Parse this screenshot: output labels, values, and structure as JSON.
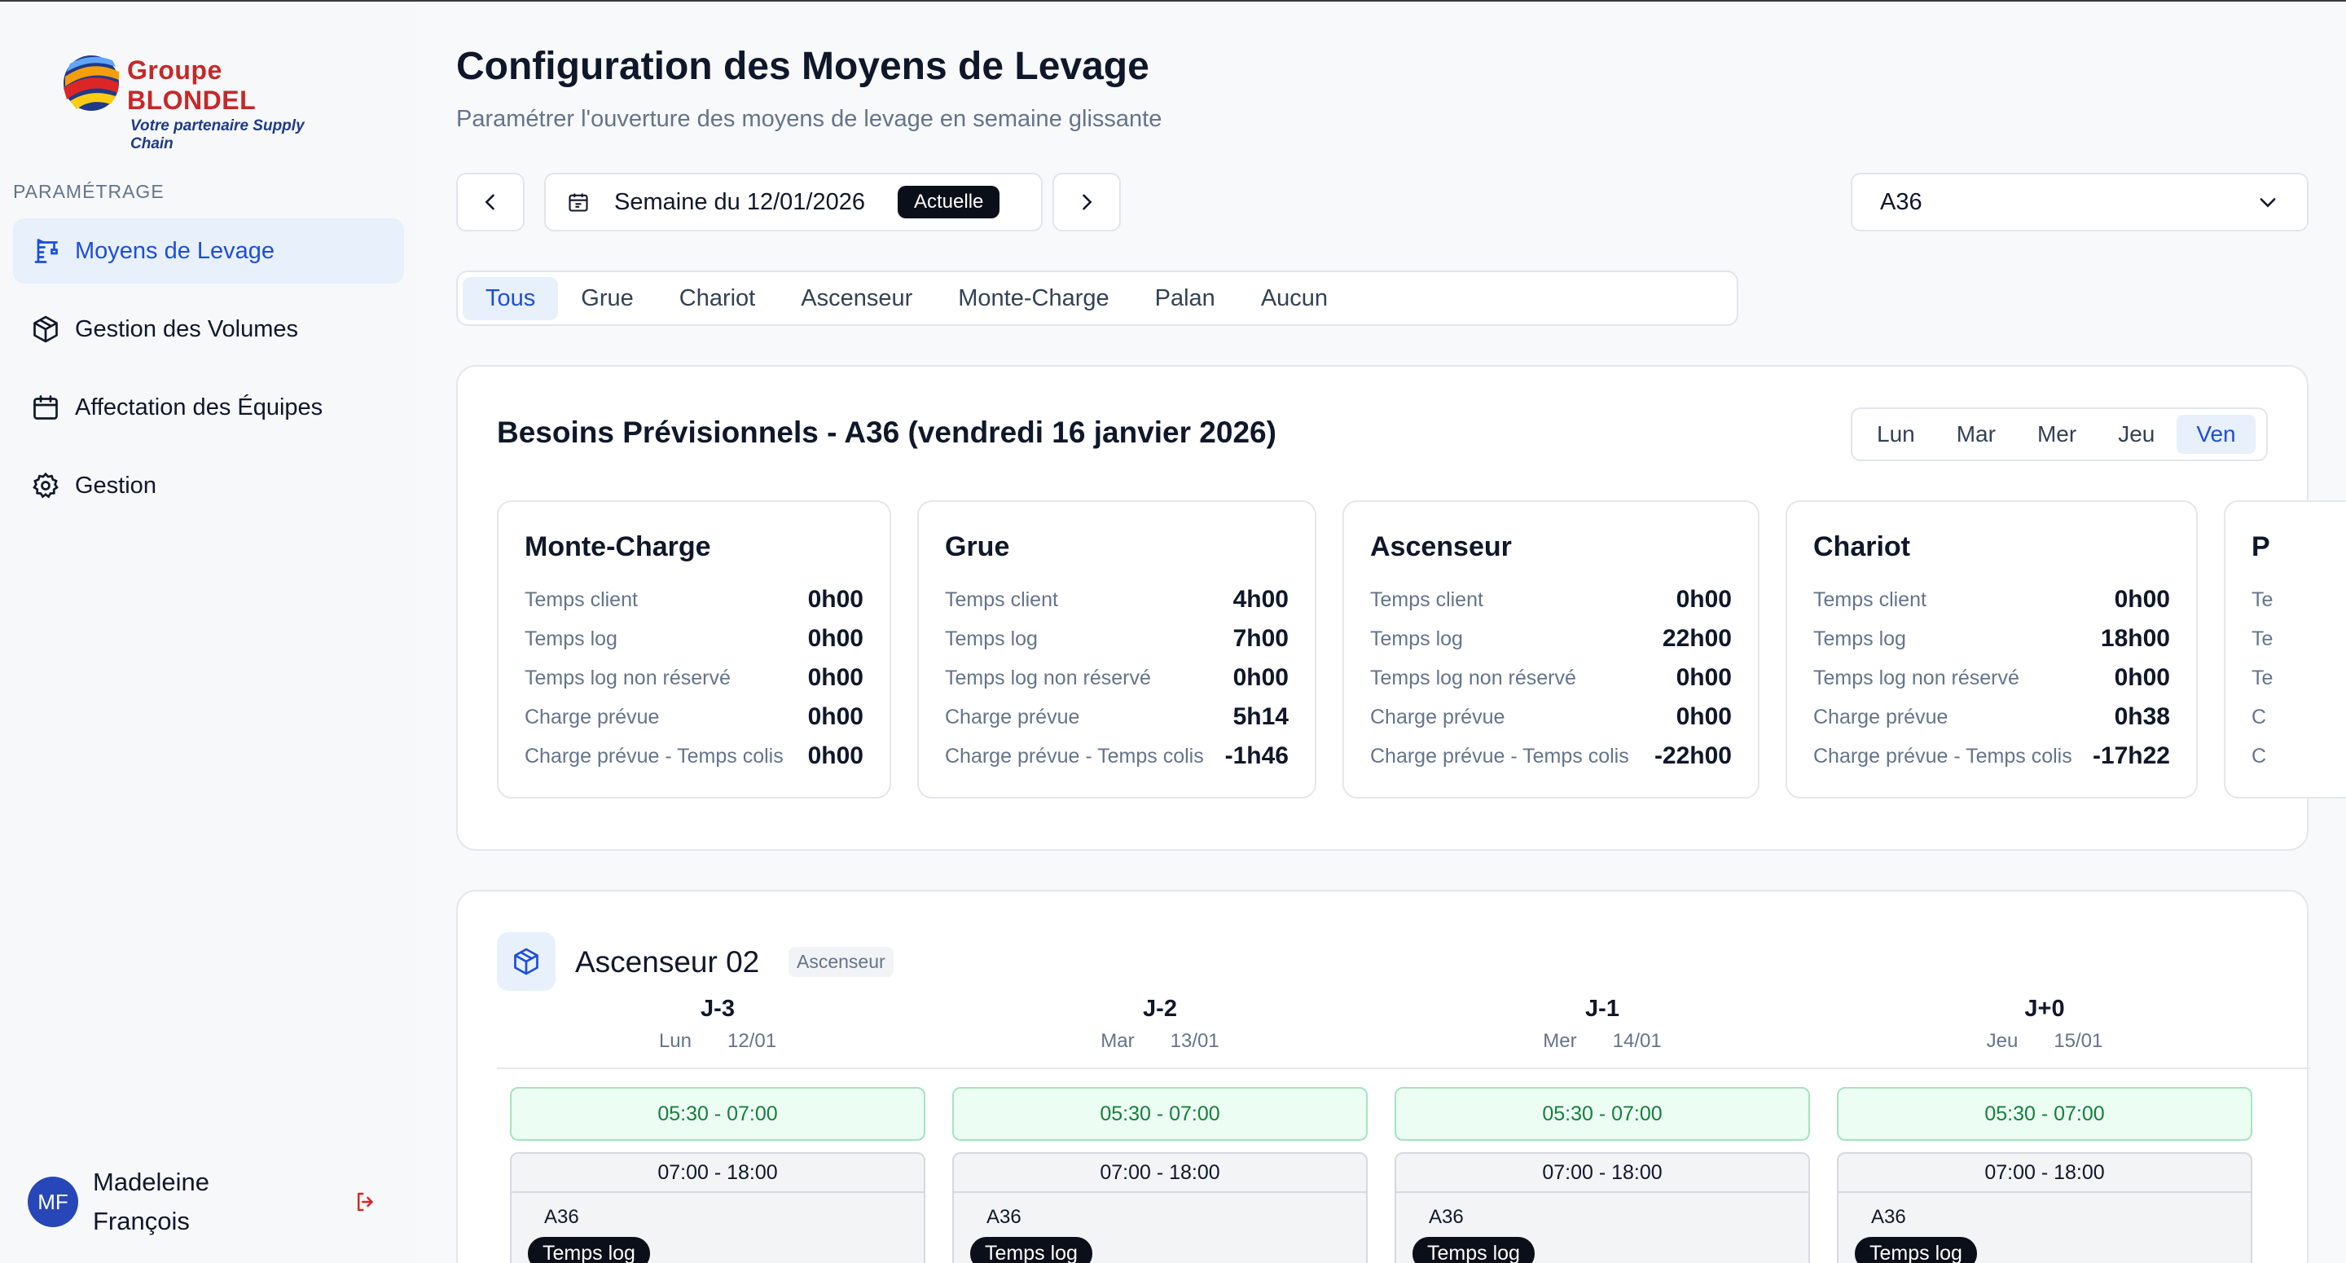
{
  "brand": {
    "name": "Groupe BLONDEL",
    "tagline": "Votre partenaire Supply Chain"
  },
  "sidebar": {
    "section": "PARAMÉTRAGE",
    "items": [
      {
        "label": "Moyens de Levage",
        "icon": "crane-icon",
        "active": true
      },
      {
        "label": "Gestion des Volumes",
        "icon": "package-icon",
        "active": false
      },
      {
        "label": "Affectation des Équipes",
        "icon": "calendar-icon",
        "active": false
      },
      {
        "label": "Gestion",
        "icon": "gear-icon",
        "active": false
      }
    ],
    "user": {
      "initials": "MF",
      "name": "Madeleine François"
    }
  },
  "header": {
    "title": "Configuration des Moyens de Levage",
    "subtitle": "Paramétrer l'ouverture des moyens de levage en semaine glissante"
  },
  "toolbar": {
    "week_label": "Semaine du 12/01/2026",
    "week_badge": "Actuelle",
    "site_select": "A36"
  },
  "filters": [
    "Tous",
    "Grue",
    "Chariot",
    "Ascenseur",
    "Monte-Charge",
    "Palan",
    "Aucun"
  ],
  "active_filter": "Tous",
  "forecast": {
    "title": "Besoins Prévisionnels - A36 (vendredi 16 janvier 2026)",
    "days": [
      "Lun",
      "Mar",
      "Mer",
      "Jeu",
      "Ven"
    ],
    "active_day": "Ven",
    "row_labels": [
      "Temps client",
      "Temps log",
      "Temps log non réservé",
      "Charge prévue",
      "Charge prévue - Temps colis"
    ],
    "cards": [
      {
        "title": "Monte-Charge",
        "values": [
          "0h00",
          "0h00",
          "0h00",
          "0h00",
          "0h00"
        ]
      },
      {
        "title": "Grue",
        "values": [
          "4h00",
          "7h00",
          "0h00",
          "5h14",
          "-1h46"
        ]
      },
      {
        "title": "Ascenseur",
        "values": [
          "0h00",
          "22h00",
          "0h00",
          "0h00",
          "-22h00"
        ]
      },
      {
        "title": "Chariot",
        "values": [
          "0h00",
          "18h00",
          "0h00",
          "0h38",
          "-17h22"
        ]
      },
      {
        "title": "P",
        "partial_labels": [
          "Te",
          "Te",
          "Te",
          "C",
          "C"
        ]
      }
    ]
  },
  "equipment": {
    "name": "Ascenseur 02",
    "type": "Ascenseur",
    "columns": [
      {
        "j": "J-3",
        "day": "Lun",
        "date": "12/01",
        "slot1": "05:30 - 07:00",
        "slot2": "07:00 - 18:00",
        "site": "A36",
        "badge": "Temps log"
      },
      {
        "j": "J-2",
        "day": "Mar",
        "date": "13/01",
        "slot1": "05:30 - 07:00",
        "slot2": "07:00 - 18:00",
        "site": "A36",
        "badge": "Temps log"
      },
      {
        "j": "J-1",
        "day": "Mer",
        "date": "14/01",
        "slot1": "05:30 - 07:00",
        "slot2": "07:00 - 18:00",
        "site": "A36",
        "badge": "Temps log"
      },
      {
        "j": "J+0",
        "day": "Jeu",
        "date": "15/01",
        "slot1": "05:30 - 07:00",
        "slot2": "07:00 - 18:00",
        "site": "A36",
        "badge": "Temps log"
      }
    ]
  },
  "colors": {
    "accent": "#1d4ed8",
    "accent_bg": "#e8f0fc",
    "green_slot": "#ecfdf3",
    "brand_red": "#c62828"
  }
}
